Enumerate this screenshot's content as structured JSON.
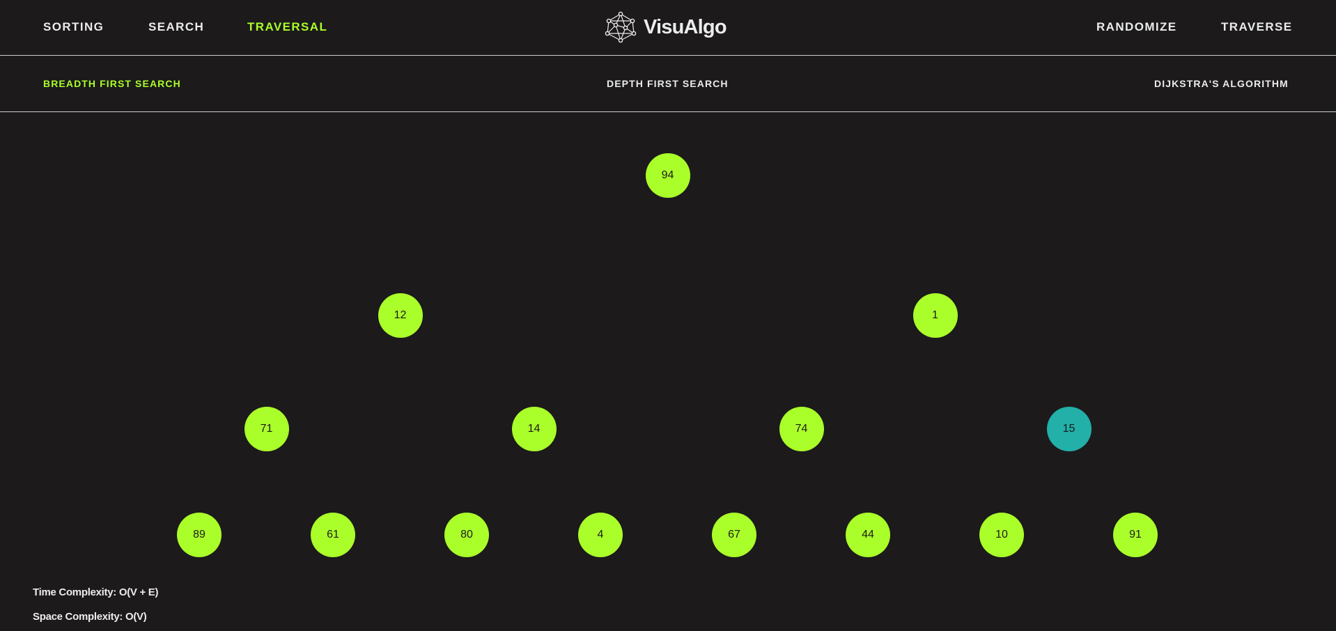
{
  "header": {
    "nav": [
      {
        "label": "SORTING",
        "active": false
      },
      {
        "label": "SEARCH",
        "active": false
      },
      {
        "label": "TRAVERSAL",
        "active": true
      }
    ],
    "brand": {
      "name": "VisuAlgo",
      "logo_icon": "network-graph-icon"
    },
    "actions": [
      {
        "label": "RANDOMIZE"
      },
      {
        "label": "TRAVERSE"
      }
    ]
  },
  "algorithm_tabs": [
    {
      "label": "BREADTH FIRST SEARCH",
      "active": true
    },
    {
      "label": "DEPTH FIRST SEARCH",
      "active": false
    },
    {
      "label": "DIJKSTRA'S ALGORITHM",
      "active": false
    }
  ],
  "tree": {
    "levels": [
      [
        94
      ],
      [
        12,
        1
      ],
      [
        71,
        14,
        74,
        15
      ],
      [
        89,
        61,
        80,
        4,
        67,
        44,
        10,
        91
      ]
    ],
    "current_node": 15
  },
  "colors": {
    "background": "#1c1a1b",
    "text": "#ececec",
    "accent": "#aaff2a",
    "visited_node": "#aaff2a",
    "current_node": "#22b0a8"
  },
  "stats": {
    "time_complexity": "Time Complexity: O(V + E)",
    "space_complexity": "Space Complexity: O(V)"
  }
}
